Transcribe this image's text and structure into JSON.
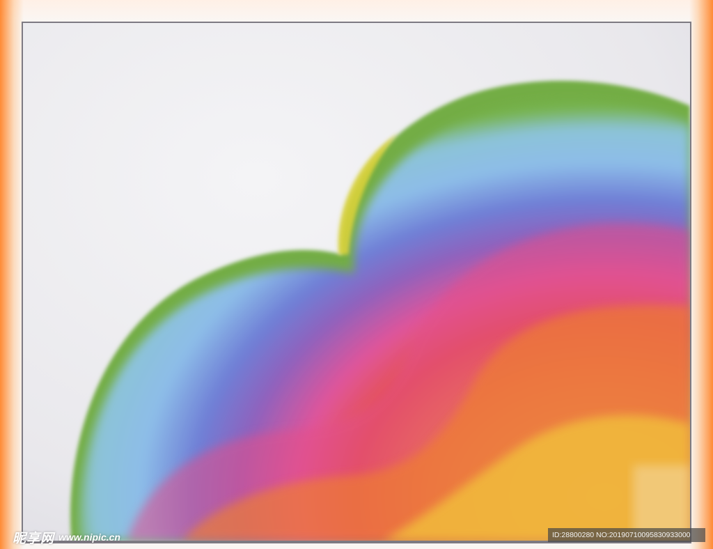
{
  "watermark": {
    "site_chinese": "昵享网",
    "site_url": "www.nipic.cn",
    "image_id_text": "ID:28800280 NO:20190710095830933000"
  },
  "palette": {
    "background": "#eceaee",
    "green": "#7fb84a",
    "light_blue": "#8cc0e8",
    "blue": "#6f86d8",
    "violet": "#7b5fb8",
    "magenta": "#e0579c",
    "red": "#e24a57",
    "orange": "#f1892f",
    "yellow": "#f3c83c",
    "frame_glow": "#ff7a1e"
  }
}
